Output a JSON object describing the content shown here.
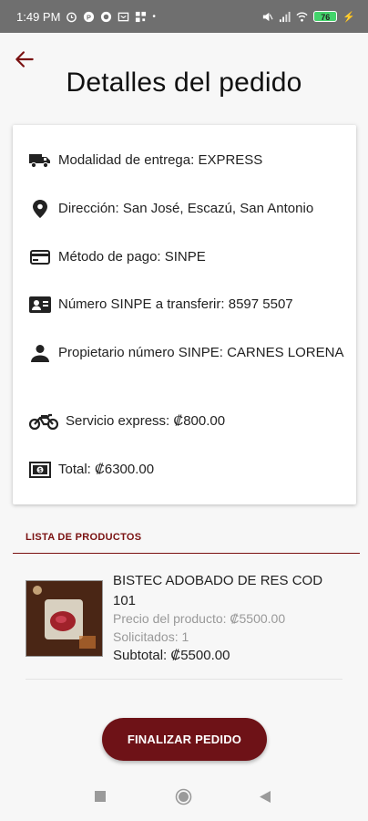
{
  "status_bar": {
    "time": "1:49 PM",
    "battery": "76"
  },
  "header": {
    "title": "Detalles del pedido"
  },
  "details": {
    "delivery": "Modalidad de entrega: EXPRESS",
    "address": "Dirección: San José, Escazú, San Antonio",
    "payment": "Método de pago: SINPE",
    "sinpe_number": "Número SINPE a transferir: 8597 5507",
    "sinpe_owner": "Propietario número SINPE: CARNES LORENA",
    "express_fee": "Servicio express: ₡800.00",
    "total": "Total: ₡6300.00"
  },
  "products_section": {
    "title": "LISTA DE PRODUCTOS",
    "items": [
      {
        "name": "BISTEC ADOBADO DE RES COD 101",
        "price": "Precio del producto: ₡5500.00",
        "qty": "Solicitados: 1",
        "subtotal": "Subtotal: ₡5500.00"
      }
    ]
  },
  "actions": {
    "finish_label": "FINALIZAR PEDIDO"
  },
  "colors": {
    "accent": "#6e1217",
    "statusbar": "#6f6f6f"
  },
  "icons": [
    "arrow-back-icon",
    "truck-icon",
    "location-pin-icon",
    "credit-card-icon",
    "contact-card-icon",
    "person-icon",
    "motorcycle-icon",
    "cash-icon"
  ]
}
